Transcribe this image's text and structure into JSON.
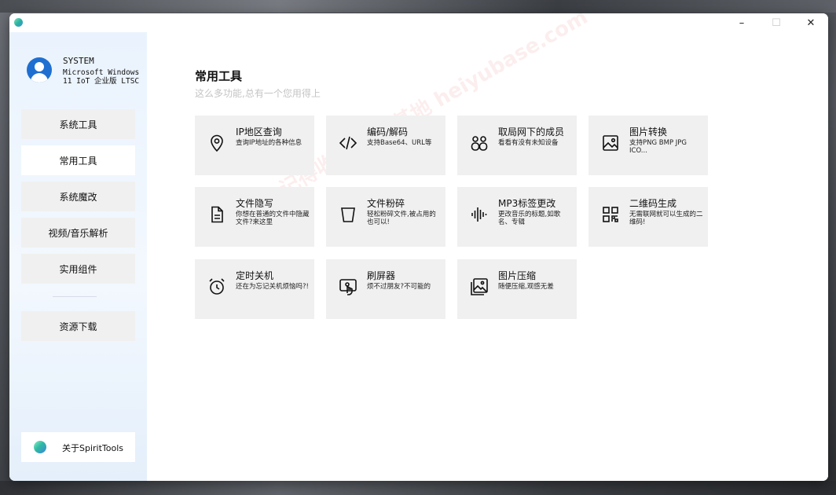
{
  "window": {
    "controls": {
      "minimize": "–",
      "maximize": "☐",
      "close": "✕"
    }
  },
  "user": {
    "name": "SYSTEM",
    "os": "Microsoft Windows 11 IoT 企业版 LTSC"
  },
  "sidebar": {
    "items": [
      {
        "label": "系统工具",
        "active": false
      },
      {
        "label": "常用工具",
        "active": true
      },
      {
        "label": "系统魔改",
        "active": false
      },
      {
        "label": "视频/音乐解析",
        "active": false
      },
      {
        "label": "实用组件",
        "active": false
      },
      {
        "label": "资源下载",
        "active": false
      }
    ],
    "about_label": "关于SpiritTools"
  },
  "main": {
    "title": "常用工具",
    "subtitle": "这么多功能,总有一个您用得上",
    "cards": [
      {
        "title": "IP地区查询",
        "desc": "查询IP地址的各种信息",
        "icon": "location-pin-icon"
      },
      {
        "title": "编码/解码",
        "desc": "支持Base64、URL等",
        "icon": "code-icon"
      },
      {
        "title": "取局网下的成员",
        "desc": "看看有没有未知设备",
        "icon": "people-icon"
      },
      {
        "title": "图片转换",
        "desc": "支持PNG BMP JPG ICO...",
        "icon": "image-icon"
      },
      {
        "title": "文件隐写",
        "desc": "你想在普通的文件中隐藏文件?来这里",
        "icon": "document-icon"
      },
      {
        "title": "文件粉碎",
        "desc": "轻松粉碎文件,被占用的也可以!",
        "icon": "trash-bin-icon"
      },
      {
        "title": "MP3标签更改",
        "desc": "更改音乐的标题,如歌名、专辑",
        "icon": "audio-wave-icon"
      },
      {
        "title": "二维码生成",
        "desc": "无需联网就可以生成的二维码!",
        "icon": "qr-code-icon"
      },
      {
        "title": "定时关机",
        "desc": "还在为忘记关机烦恼吗?!",
        "icon": "alarm-clock-icon"
      },
      {
        "title": "刷屏器",
        "desc": "烦不过朋友?不可能的",
        "icon": "touch-screen-icon"
      },
      {
        "title": "图片压缩",
        "desc": "随便压缩,观感无差",
        "icon": "image-compress-icon"
      }
    ]
  },
  "watermark": "记得收藏:黑域基地 heiyubase.com"
}
